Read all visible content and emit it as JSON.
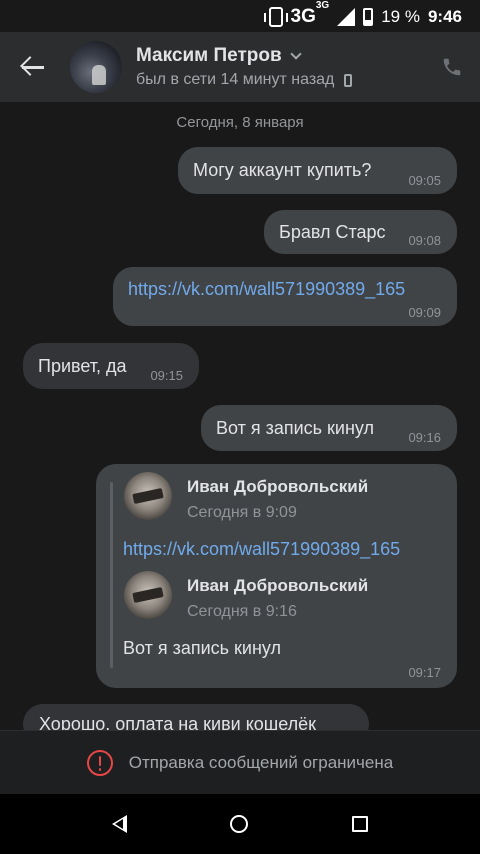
{
  "status_bar": {
    "network": "3G",
    "network_sup": "3G",
    "battery": "19 %",
    "time": "9:46"
  },
  "header": {
    "contact_name": "Максим Петров",
    "status": "был в сети 14 минут назад"
  },
  "chat": {
    "date_separator": "Сегодня, 8 января",
    "messages": [
      {
        "text": "Могу аккаунт купить?",
        "time": "09:05",
        "direction": "out"
      },
      {
        "text": "Бравл Старс",
        "time": "09:08",
        "direction": "out"
      },
      {
        "text": "https://vk.com/wall571990389_165",
        "time": "09:09",
        "direction": "out",
        "is_link": true
      },
      {
        "text": "Привет, да",
        "time": "09:15",
        "direction": "in"
      },
      {
        "text": "Вот я запись кинул",
        "time": "09:16",
        "direction": "out"
      }
    ],
    "repost": {
      "time": "09:17",
      "author": "Иван Добровольский",
      "date": "Сегодня в 9:09",
      "link": "https://vk.com/wall571990389_165",
      "inner_author": "Иван Добровольский",
      "inner_date": "Сегодня в 9:16",
      "inner_text": "Вот я запись кинул"
    },
    "partial_message": "Хорошо, оплата на киви кошелёк"
  },
  "restricted": {
    "text": "Отправка сообщений ограничена"
  },
  "colors": {
    "background": "#19191a",
    "header": "#2c2d2e",
    "bubble_out": "#414447",
    "bubble_in": "#333437",
    "link": "#71aaeb",
    "warning": "#e64646"
  }
}
